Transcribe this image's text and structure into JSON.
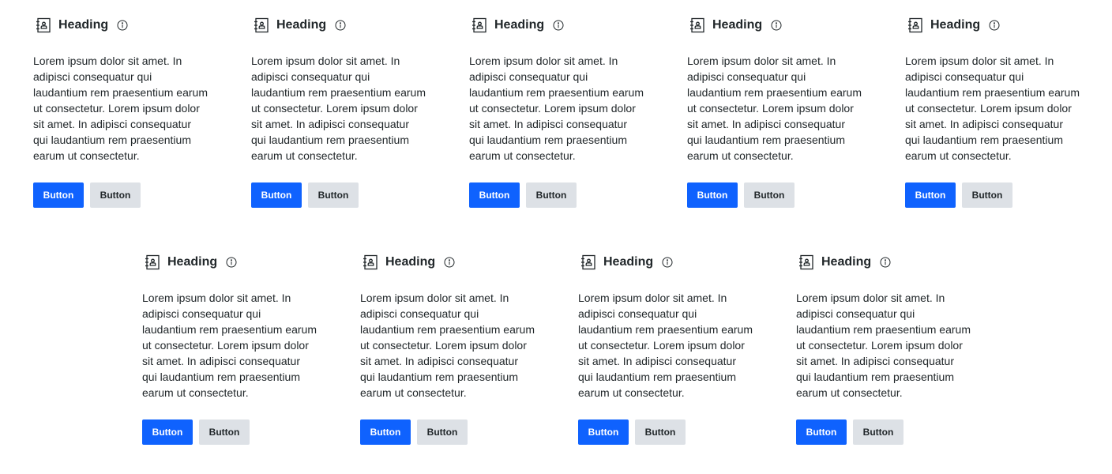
{
  "colors": {
    "primary": "#0f62fe",
    "secondary": "#dde1e6",
    "text": "#21272a"
  },
  "cards": [
    {
      "icon": "contact-book-icon",
      "title": "Heading",
      "info_icon": "info-icon",
      "body": "Lorem ipsum dolor sit amet. In adipisci consequatur qui laudantium rem praesentium earum ut consectetur. Lorem ipsum dolor sit amet. In adipisci consequatur qui laudantium rem praesentium earum ut consectetur.",
      "primary_label": "Button",
      "secondary_label": "Button"
    },
    {
      "icon": "contact-book-icon",
      "title": "Heading",
      "info_icon": "info-icon",
      "body": "Lorem ipsum dolor sit amet. In adipisci consequatur qui laudantium rem praesentium earum ut consectetur. Lorem ipsum dolor sit amet. In adipisci consequatur qui laudantium rem praesentium earum ut consectetur.",
      "primary_label": "Button",
      "secondary_label": "Button"
    },
    {
      "icon": "contact-book-icon",
      "title": "Heading",
      "info_icon": "info-icon",
      "body": "Lorem ipsum dolor sit amet. In adipisci consequatur qui laudantium rem praesentium earum ut consectetur. Lorem ipsum dolor sit amet. In adipisci consequatur qui laudantium rem praesentium earum ut consectetur.",
      "primary_label": "Button",
      "secondary_label": "Button"
    },
    {
      "icon": "contact-book-icon",
      "title": "Heading",
      "info_icon": "info-icon",
      "body": "Lorem ipsum dolor sit amet. In adipisci consequatur qui laudantium rem praesentium earum ut consectetur. Lorem ipsum dolor sit amet. In adipisci consequatur qui laudantium rem praesentium earum ut consectetur.",
      "primary_label": "Button",
      "secondary_label": "Button"
    },
    {
      "icon": "contact-book-icon",
      "title": "Heading",
      "info_icon": "info-icon",
      "body": "Lorem ipsum dolor sit amet. In adipisci consequatur qui laudantium rem praesentium earum ut consectetur. Lorem ipsum dolor sit amet. In adipisci consequatur qui laudantium rem praesentium earum ut consectetur.",
      "primary_label": "Button",
      "secondary_label": "Button"
    },
    {
      "icon": "contact-book-icon",
      "title": "Heading",
      "info_icon": "info-icon",
      "body": "Lorem ipsum dolor sit amet. In adipisci consequatur qui laudantium rem praesentium earum ut consectetur. Lorem ipsum dolor sit amet. In adipisci consequatur qui laudantium rem praesentium earum ut consectetur.",
      "primary_label": "Button",
      "secondary_label": "Button"
    },
    {
      "icon": "contact-book-icon",
      "title": "Heading",
      "info_icon": "info-icon",
      "body": "Lorem ipsum dolor sit amet. In adipisci consequatur qui laudantium rem praesentium earum ut consectetur. Lorem ipsum dolor sit amet. In adipisci consequatur qui laudantium rem praesentium earum ut consectetur.",
      "primary_label": "Button",
      "secondary_label": "Button"
    },
    {
      "icon": "contact-book-icon",
      "title": "Heading",
      "info_icon": "info-icon",
      "body": "Lorem ipsum dolor sit amet. In adipisci consequatur qui laudantium rem praesentium earum ut consectetur. Lorem ipsum dolor sit amet. In adipisci consequatur qui laudantium rem praesentium earum ut consectetur.",
      "primary_label": "Button",
      "secondary_label": "Button"
    },
    {
      "icon": "contact-book-icon",
      "title": "Heading",
      "info_icon": "info-icon",
      "body": "Lorem ipsum dolor sit amet. In adipisci consequatur qui laudantium rem praesentium earum ut consectetur. Lorem ipsum dolor sit amet. In adipisci consequatur qui laudantium rem praesentium earum ut consectetur.",
      "primary_label": "Button",
      "secondary_label": "Button"
    }
  ]
}
